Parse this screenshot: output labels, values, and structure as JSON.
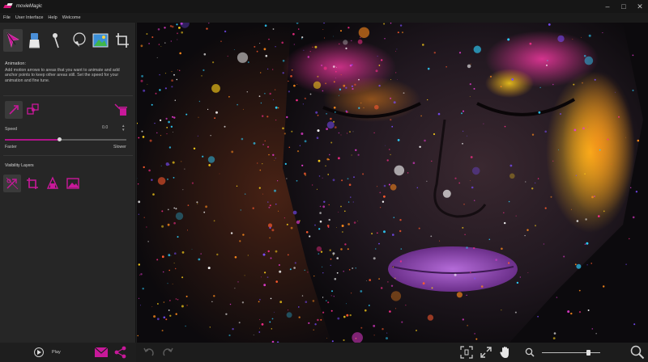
{
  "app": {
    "title": "movieMagic",
    "window_controls": [
      "–",
      "□",
      "✕"
    ]
  },
  "menu": {
    "items": [
      "File",
      "User Interface",
      "Help",
      "Welcome"
    ]
  },
  "toolbar": {
    "tools": [
      {
        "name": "motion-arrow-tool",
        "icon": "motion-arrow-icon",
        "active": true
      },
      {
        "name": "eraser-tool",
        "icon": "eraser-icon",
        "active": false
      },
      {
        "name": "pin-tool",
        "icon": "pin-icon",
        "active": false
      },
      {
        "name": "lasso-tool",
        "icon": "lasso-icon",
        "active": false
      },
      {
        "name": "image-tool",
        "icon": "image-icon",
        "active": false
      },
      {
        "name": "crop-tool",
        "icon": "crop-icon",
        "active": false
      }
    ]
  },
  "panel": {
    "title": "Animation:",
    "description": "Add motion arrows to areas that you want to animate and add anchor points to keep other areas still. Set the speed for your animation and fine tune.",
    "speed_label": "Speed",
    "speed_value": "0.0",
    "speed_level": 0.45,
    "faster_label": "Faster",
    "slower_label": "Slower",
    "visibility_label": "Visibility Layers"
  },
  "playback": {
    "play_label": "Play"
  },
  "colors": {
    "accent": "#b0148a",
    "accent_icon": "#c8189a",
    "panel_bg": "#262626",
    "canvas_bg": "#0c0a0d"
  },
  "zoom": {
    "level": 0.8
  }
}
